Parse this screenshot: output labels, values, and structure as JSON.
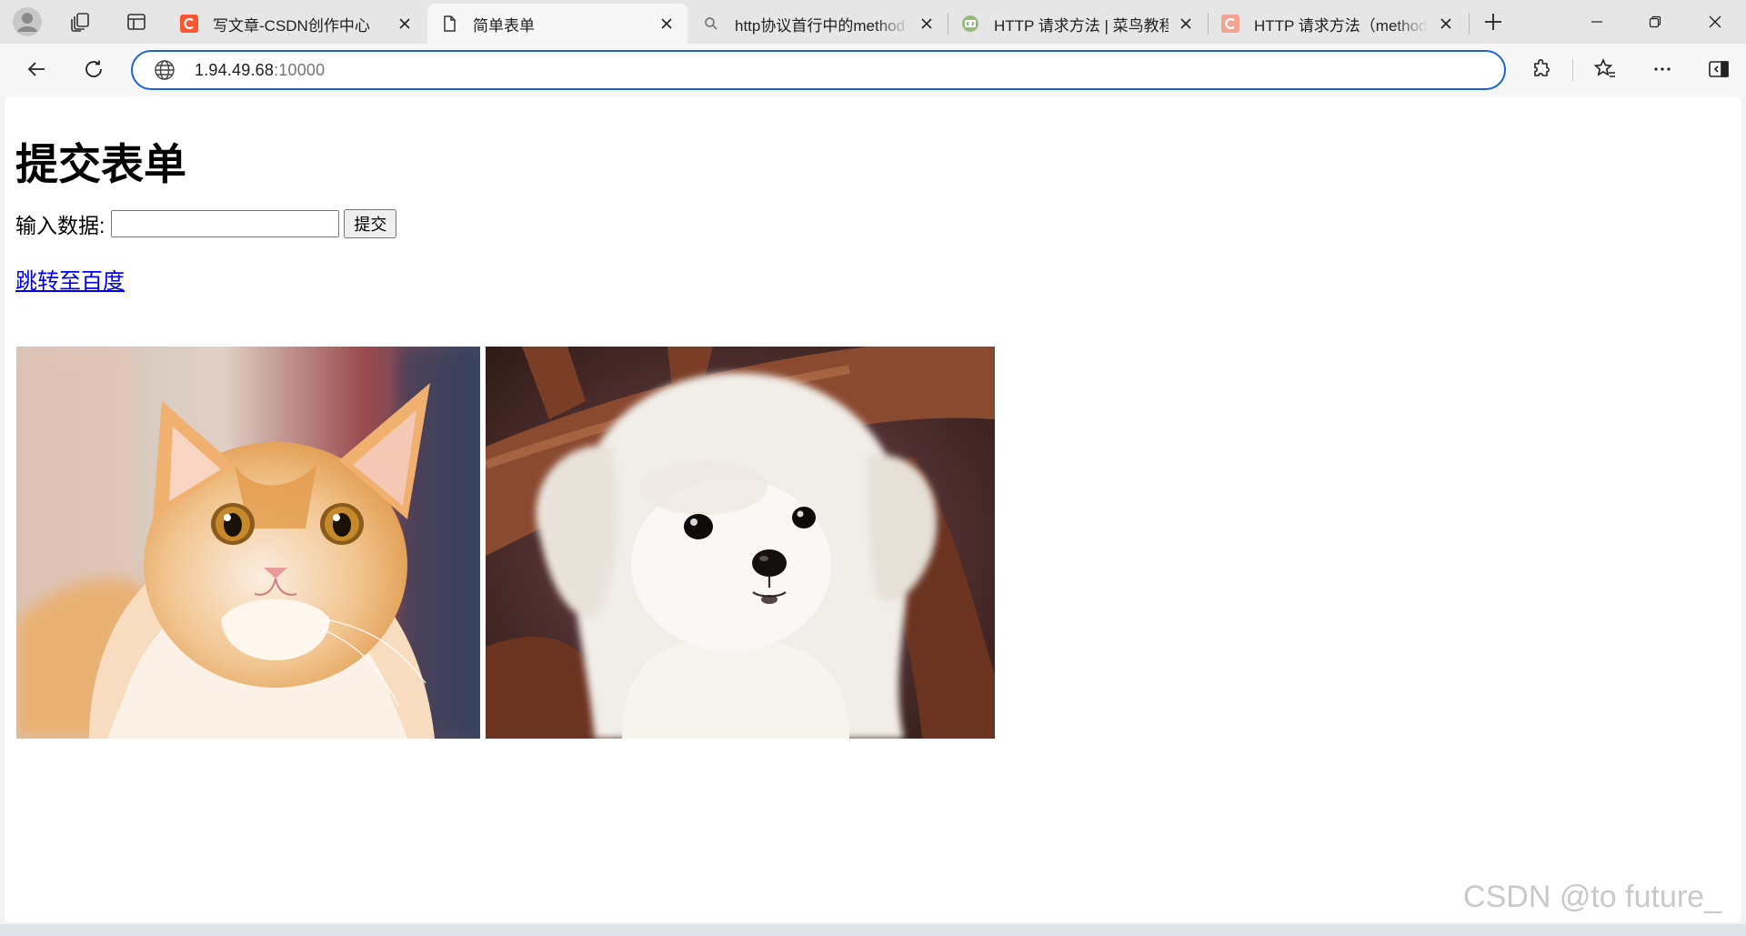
{
  "browser": {
    "tabs": [
      {
        "title": "写文章-CSDN创作中心",
        "favicon": "csdn-logo-icon",
        "active": false
      },
      {
        "title": "简单表单",
        "favicon": "page-icon",
        "active": true
      },
      {
        "title": "http协议首行中的method",
        "favicon": "search-icon",
        "active": false
      },
      {
        "title": "HTTP 请求方法 | 菜鸟教程",
        "favicon": "runoob-logo-icon",
        "active": false
      },
      {
        "title": "HTTP 请求方法（method）",
        "favicon": "csdn-logo-icon",
        "active": false
      }
    ],
    "address": {
      "host": "1.94.49.68",
      "port": ":10000"
    },
    "colors": {
      "accent": "#1a64d8",
      "csdn": "#fc5531",
      "runoob": "#96b97d"
    }
  },
  "page": {
    "title": "提交表单",
    "form": {
      "label": "输入数据:",
      "input_value": "",
      "submit_label": "提交"
    },
    "link_text": "跳转至百度",
    "images": [
      {
        "subject": "orange and white cat"
      },
      {
        "subject": "white maltese puppy"
      }
    ]
  },
  "watermark": "CSDN @to future_"
}
